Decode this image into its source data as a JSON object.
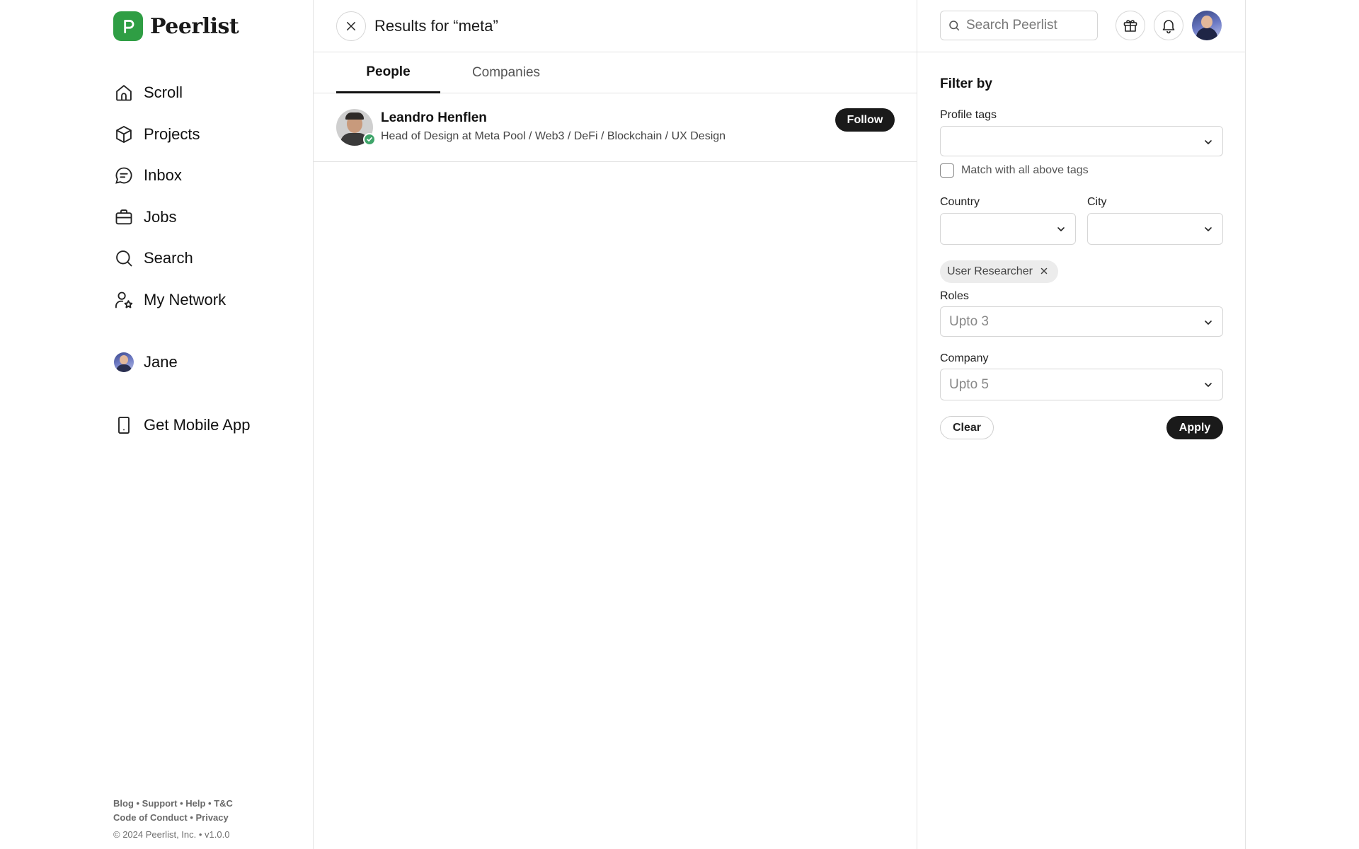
{
  "brand": {
    "name": "Peerlist",
    "color": "#2f9e44"
  },
  "sidebar": {
    "items": [
      {
        "label": "Scroll",
        "icon": "home-icon"
      },
      {
        "label": "Projects",
        "icon": "cube-icon"
      },
      {
        "label": "Inbox",
        "icon": "chat-icon"
      },
      {
        "label": "Jobs",
        "icon": "briefcase-icon"
      },
      {
        "label": "Search",
        "icon": "search-icon"
      },
      {
        "label": "My Network",
        "icon": "user-star-icon"
      }
    ],
    "profile_label": "Jane",
    "mobile_app_label": "Get Mobile App",
    "footer_links_1": "Blog • Support • Help • T&C",
    "footer_links_2": "Code of Conduct • Privacy",
    "footer_copy": "© 2024 Peerlist, Inc. • v1.0.0"
  },
  "main": {
    "results_title": "Results for “meta”",
    "tabs": [
      {
        "label": "People",
        "active": true
      },
      {
        "label": "Companies",
        "active": false
      }
    ],
    "results": [
      {
        "name": "Leandro Henflen",
        "headline": "Head of Design at Meta Pool / Web3 / DeFi / Blockchain / UX Design",
        "verified": true,
        "action_label": "Follow"
      }
    ]
  },
  "header": {
    "search_placeholder": "Search Peerlist"
  },
  "filter": {
    "title": "Filter by",
    "profile_tags_label": "Profile tags",
    "match_all_label": "Match with all above tags",
    "country_label": "Country",
    "city_label": "City",
    "selected_chip": "User Researcher",
    "roles_label": "Roles",
    "roles_value": "Upto 3",
    "company_label": "Company",
    "company_value": "Upto 5",
    "clear_label": "Clear",
    "apply_label": "Apply"
  }
}
